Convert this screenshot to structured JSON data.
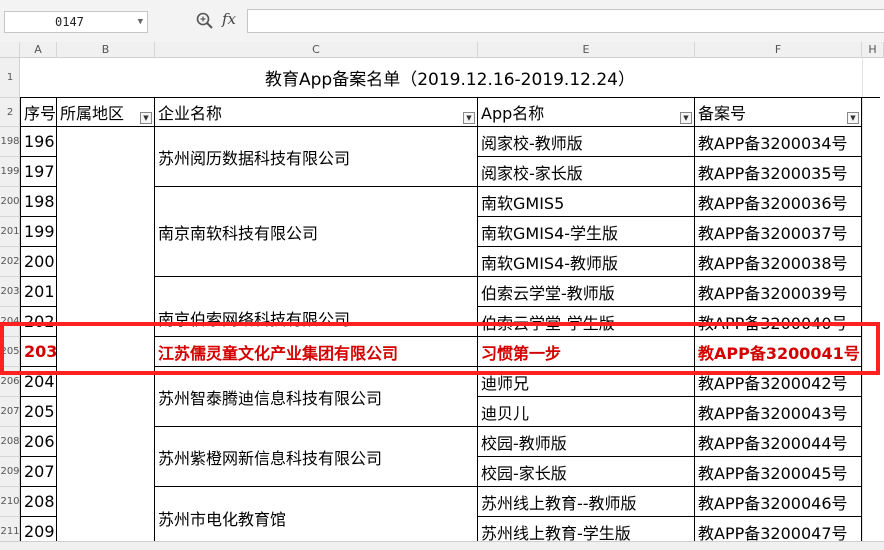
{
  "formula_bar": {
    "name_box_value": "0147",
    "zoom_icon": "zoom-icon",
    "fx_label": "fx",
    "formula_value": ""
  },
  "columns": [
    "A",
    "B",
    "C",
    "E",
    "F",
    "H"
  ],
  "row_numbers": [
    "1",
    "2",
    "198",
    "199",
    "200",
    "201",
    "202",
    "203",
    "204",
    "205",
    "206",
    "207",
    "208",
    "209",
    "210",
    "211"
  ],
  "sheet": {
    "title": "教育App备案名单（2019.12.16-2019.12.24）",
    "headers": [
      "序号",
      "所属地区",
      "企业名称",
      "App名称",
      "备案号"
    ],
    "seq": [
      "196",
      "197",
      "198",
      "199",
      "200",
      "201",
      "202",
      "203",
      "204",
      "205",
      "206",
      "207",
      "208",
      "209"
    ],
    "companies": [
      "苏州阅历数据科技有限公司",
      "南京南软科技有限公司",
      "南京伯索网络科技有限公司",
      "江苏儒灵童文化产业集团有限公司",
      "苏州智泰腾迪信息科技有限公司",
      "苏州紫橙网新信息科技有限公司",
      "苏州市电化教育馆"
    ],
    "apps": [
      "阅家校-教师版",
      "阅家校-家长版",
      "南软GMIS5",
      "南软GMIS4-学生版",
      "南软GMIS4-教师版",
      "伯索云学堂-教师版",
      "伯索云学堂-学生版",
      "习惯第一步",
      "迪师兄",
      "迪贝儿",
      "校园-教师版",
      "校园-家长版",
      "苏州线上教育--教师版",
      "苏州线上教育-学生版"
    ],
    "records": [
      "教APP备3200034号",
      "教APP备3200035号",
      "教APP备3200036号",
      "教APP备3200037号",
      "教APP备3200038号",
      "教APP备3200039号",
      "教APP备3200040号",
      "教APP备3200041号",
      "教APP备3200042号",
      "教APP备3200043号",
      "教APP备3200044号",
      "教APP备3200045号",
      "教APP备3200046号",
      "教APP备3200047号"
    ]
  },
  "colors": {
    "highlight": "#ff2020",
    "highlight_text": "#d40000"
  }
}
